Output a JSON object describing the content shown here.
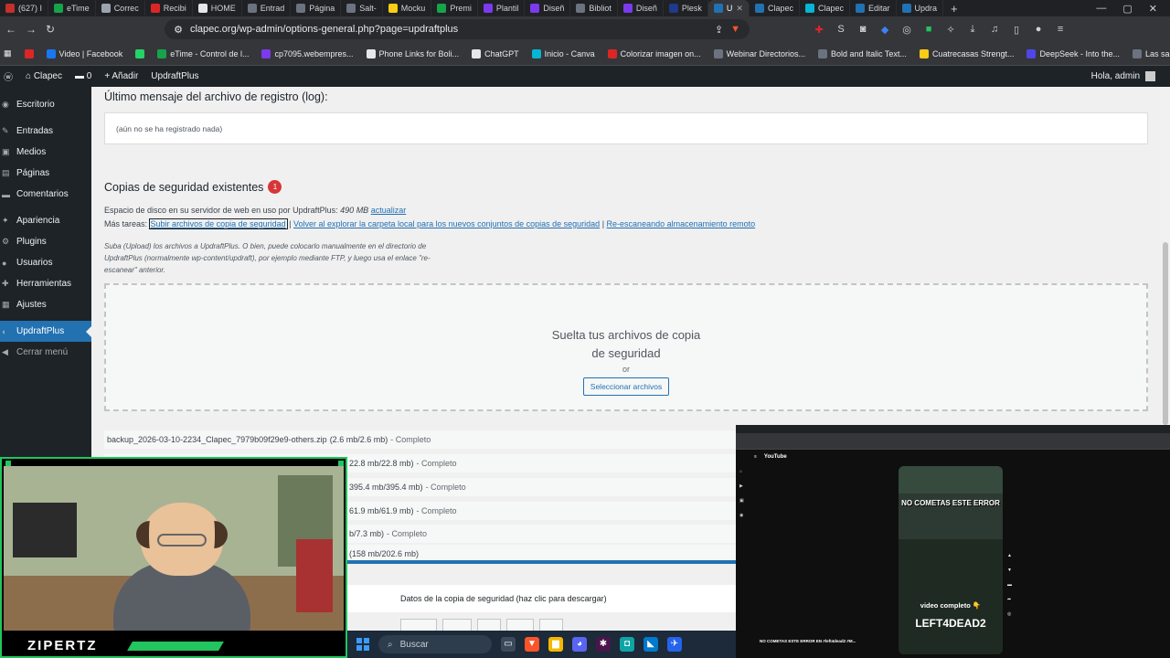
{
  "browser": {
    "tabs": [
      {
        "label": "(627) I",
        "color": "#c4302b"
      },
      {
        "label": "eTime",
        "color": "#16a34a"
      },
      {
        "label": "Correc",
        "color": "#9ca3af"
      },
      {
        "label": "Recibi",
        "color": "#dc2626"
      },
      {
        "label": "HOME",
        "color": "#e5e7eb"
      },
      {
        "label": "Entrad",
        "color": "#6b7280"
      },
      {
        "label": "Página",
        "color": "#6b7280"
      },
      {
        "label": "Salt-",
        "color": "#6b7280"
      },
      {
        "label": "Mocku",
        "color": "#facc15"
      },
      {
        "label": "Premi",
        "color": "#16a34a"
      },
      {
        "label": "Plantil",
        "color": "#7c3aed"
      },
      {
        "label": "Diseñ",
        "color": "#7c3aed"
      },
      {
        "label": "Bibliot",
        "color": "#6b7280"
      },
      {
        "label": "Diseñ",
        "color": "#7c3aed"
      },
      {
        "label": "Plesk",
        "color": "#1e3a8a"
      },
      {
        "label": "U",
        "color": "#2271b1",
        "active": true
      },
      {
        "label": "Clapec",
        "color": "#2271b1"
      },
      {
        "label": "Clapec",
        "color": "#06b6d4"
      },
      {
        "label": "Editar",
        "color": "#2271b1"
      },
      {
        "label": "Updra",
        "color": "#2271b1"
      }
    ],
    "url": "clapec.org/wp-admin/options-general.php?page=updraftplus",
    "bookmarks": [
      {
        "label": "",
        "color": "#dc2626"
      },
      {
        "label": "Video | Facebook",
        "color": "#1877f2"
      },
      {
        "label": "",
        "color": "#25d366"
      },
      {
        "label": "eTime - Control de l...",
        "color": "#16a34a"
      },
      {
        "label": "cp7095.webempres...",
        "color": "#7c3aed"
      },
      {
        "label": "Phone Links for Boli...",
        "color": "#e5e7eb"
      },
      {
        "label": "ChatGPT",
        "color": "#e5e7eb"
      },
      {
        "label": "Inicio - Canva",
        "color": "#06b6d4"
      },
      {
        "label": "Colorizar imagen on...",
        "color": "#dc2626"
      },
      {
        "label": "Webinar Directorios...",
        "color": "#6b7280"
      },
      {
        "label": "Bold and Italic Text...",
        "color": "#6b7280"
      },
      {
        "label": "Cuatrecasas Strengt...",
        "color": "#facc15"
      },
      {
        "label": "DeepSeek - Into the...",
        "color": "#4f46e5"
      },
      {
        "label": "Las sabrosas recetas...",
        "color": "#6b7280"
      }
    ]
  },
  "adminbar": {
    "site": "Clapec",
    "comments": "0",
    "add": "Añadir",
    "plugin": "UpdraftPlus",
    "greeting": "Hola, admin"
  },
  "sidebar": {
    "items": [
      {
        "label": "Escritorio",
        "icon": "◉"
      },
      {
        "label": "Entradas",
        "icon": "✎"
      },
      {
        "label": "Medios",
        "icon": "▣"
      },
      {
        "label": "Páginas",
        "icon": "▤"
      },
      {
        "label": "Comentarios",
        "icon": "▬"
      },
      {
        "label": "Apariencia",
        "icon": "✦"
      },
      {
        "label": "Plugins",
        "icon": "⚙"
      },
      {
        "label": "Usuarios",
        "icon": "●"
      },
      {
        "label": "Herramientas",
        "icon": "✚"
      },
      {
        "label": "Ajustes",
        "icon": "▦"
      },
      {
        "label": "UpdraftPlus",
        "icon": "◐",
        "active": true
      },
      {
        "label": "Cerrar menú",
        "icon": "◀"
      }
    ]
  },
  "main": {
    "log_heading": "Último mensaje del archivo de registro (log):",
    "log_text": "(aún no se ha registrado nada)",
    "copies_heading": "Copias de seguridad existentes",
    "copies_badge": "1",
    "disk_label": "Espacio de disco en su servidor de web en uso por UpdraftPlus:",
    "disk_value": "490 MB",
    "disk_link": "actualizar",
    "tasks_label": "Más tareas:",
    "task_upload": "Subir archivos de copia de seguridad",
    "task_rescan_local": "Volver al explorar la carpeta local para los nuevos conjuntos de copias de seguridad",
    "task_rescan_remote": "Re-escaneando almacenamiento remoto",
    "upload_note": "Suba (Upload) los archivos a UpdraftPlus. O bien, puede colocarlo manualmente en el directorio de UpdraftPlus (normalmente wp-content/updraft), por ejemplo mediante FTP, y luego usa el enlace \"re-escanear\" anterior.",
    "drop_line1": "Suelta tus archivos de copia",
    "drop_line2": "de seguridad",
    "drop_or": "or",
    "drop_button": "Seleccionar archivos",
    "uploads": [
      {
        "name": "backup_2026-03-10-2234_Clapec_7979b09f29e9-others.zip",
        "size": "(2.6 mb/2.6 mb)",
        "status": "- Completo"
      },
      {
        "name": "",
        "size": "22.8 mb/22.8 mb)",
        "status": "- Completo"
      },
      {
        "name": "",
        "size": "395.4 mb/395.4 mb)",
        "status": "- Completo"
      },
      {
        "name": "",
        "size": "61.9 mb/61.9 mb)",
        "status": "- Completo"
      },
      {
        "name": "",
        "size": "b/7.3 mb)",
        "status": "- Completo"
      },
      {
        "name": "",
        "size": "(158 mb/202.6 mb)",
        "status": ""
      }
    ],
    "datos_label": "Datos de la copia de seguridad (haz clic para descargar)"
  },
  "webcam": {
    "name": "ZIPERTZ"
  },
  "youtube": {
    "title_overlay": "NO COMETAS ESTE ERROR",
    "sub_overlay": "video completo 👇",
    "game_logo": "LEFT4DEAD2",
    "caption": "NO COMETAS ESTE ERROR EN #left4dead2 #M...",
    "logo": "YouTube"
  },
  "taskbar": {
    "search_placeholder": "Buscar"
  }
}
